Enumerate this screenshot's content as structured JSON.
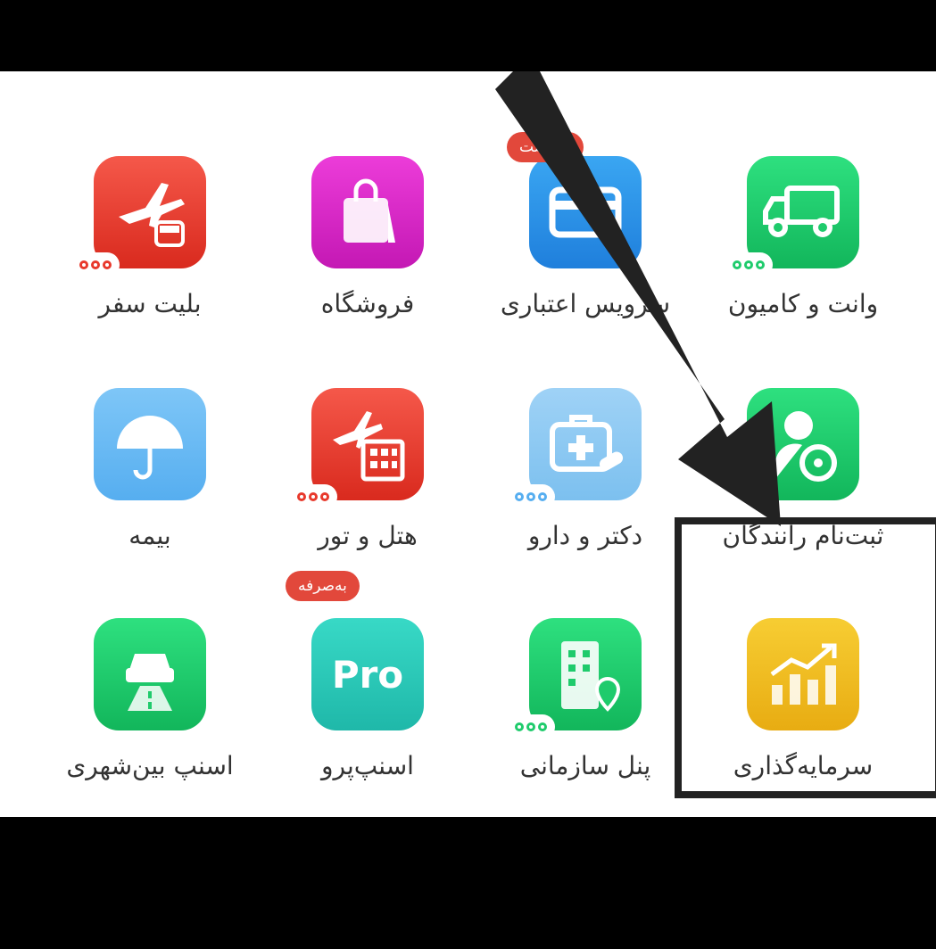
{
  "tiles": [
    {
      "id": "truck",
      "label": "وانت و کامیون",
      "icon": "truck-icon",
      "color": "#1fcb6c",
      "dots": true
    },
    {
      "id": "credit",
      "label": "سرویس اعتباری",
      "icon": "credit-card-icon",
      "color": "#2a92e6",
      "badge": "بازگشت"
    },
    {
      "id": "shop",
      "label": "فروشگاه",
      "icon": "shopping-bag-icon",
      "color": "#d82ac6"
    },
    {
      "id": "ticket",
      "label": "بلیت سفر",
      "icon": "plane-bus-icon",
      "color": "#e8392c",
      "dots": true
    },
    {
      "id": "driver",
      "label": "ثبت‌نام رانندگان",
      "icon": "driver-steering-icon",
      "color": "#1fcb6c"
    },
    {
      "id": "doctor",
      "label": "دکتر و دارو",
      "icon": "medical-kit-icon",
      "color": "#8cc8f3",
      "dots": true
    },
    {
      "id": "hotel",
      "label": "هتل و تور",
      "icon": "plane-hotel-icon",
      "color": "#e8392c",
      "dots": true
    },
    {
      "id": "insurance",
      "label": "بیمه",
      "icon": "umbrella-icon",
      "color": "#56aef0"
    },
    {
      "id": "invest",
      "label": "سرمایه‌گذاری",
      "icon": "growth-chart-icon",
      "color": "#f0be22"
    },
    {
      "id": "org",
      "label": "پنل سازمانی",
      "icon": "building-location-icon",
      "color": "#1fcb6c",
      "dots": true
    },
    {
      "id": "pro",
      "label": "اسنپ‌پرو",
      "icon": "pro-icon",
      "color": "#2cc9b8",
      "badge": "به‌صرفه",
      "pro_text": "Pro"
    },
    {
      "id": "intercity",
      "label": "اسنپ بین‌شهری",
      "icon": "car-road-icon",
      "color": "#1fcb6c"
    }
  ]
}
